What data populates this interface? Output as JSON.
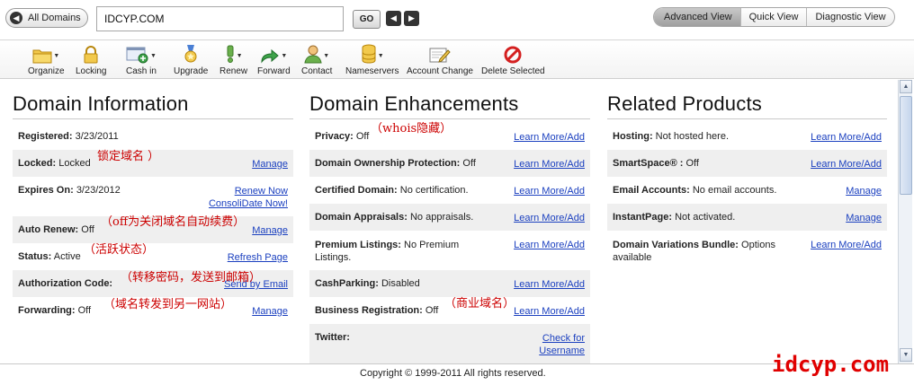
{
  "topbar": {
    "back_label": "All Domains",
    "domain_value": "IDCYP.COM",
    "go_label": "GO",
    "view_tabs": [
      "Advanced View",
      "Quick View",
      "Diagnostic View"
    ]
  },
  "toolbar": {
    "items": [
      {
        "label": "Organize",
        "icon": "folder-icon"
      },
      {
        "label": "Locking",
        "icon": "lock-icon"
      },
      {
        "label": "Cash in",
        "icon": "cash-in-icon"
      },
      {
        "label": "Upgrade",
        "icon": "medal-icon"
      },
      {
        "label": "Renew",
        "icon": "renew-icon"
      },
      {
        "label": "Forward",
        "icon": "forward-arrow-icon"
      },
      {
        "label": "Contact",
        "icon": "contact-person-icon"
      },
      {
        "label": "Nameservers",
        "icon": "database-icon"
      },
      {
        "label": "Account Change",
        "icon": "edit-pencil-icon"
      },
      {
        "label": "Delete Selected",
        "icon": "no-entry-icon"
      }
    ]
  },
  "domain_info": {
    "title": "Domain Information",
    "rows": [
      {
        "label": "Registered:",
        "value": "3/23/2011"
      },
      {
        "label": "Locked:",
        "value": "Locked",
        "link": "Manage",
        "note": "锁定域名 ）"
      },
      {
        "label": "Expires On:",
        "value": "3/23/2012",
        "link": "Renew Now",
        "link2": "ConsoliDate Now!"
      },
      {
        "label": "Auto Renew:",
        "value": "Off",
        "link": "Manage",
        "note": "（off为关闭域名自动续费）"
      },
      {
        "label": "Status:",
        "value": "Active",
        "link": "Refresh Page",
        "note": "（活跃状态）"
      },
      {
        "label": "Authorization Code:",
        "value": "",
        "link": "Send by Email",
        "note": "（转移密码，发送到邮箱）"
      },
      {
        "label": "Forwarding:",
        "value": "Off",
        "link": "Manage",
        "note": "（域名转发到另一网站）"
      }
    ]
  },
  "enhancements": {
    "title": "Domain Enhancements",
    "rows": [
      {
        "label": "Privacy:",
        "value": "Off",
        "link": "Learn More/Add",
        "note": "（whois隐藏）"
      },
      {
        "label": "Domain Ownership Protection:",
        "value": "Off",
        "link": "Learn More/Add"
      },
      {
        "label": "Certified Domain:",
        "value": "No certification.",
        "link": "Learn More/Add"
      },
      {
        "label": "Domain Appraisals:",
        "value": "No appraisals.",
        "link": "Learn More/Add"
      },
      {
        "label": "Premium Listings:",
        "value": "No Premium",
        "value2": "Listings.",
        "link": "Learn More/Add"
      },
      {
        "label": "CashParking:",
        "value": "Disabled",
        "link": "Learn More/Add"
      },
      {
        "label": "Business Registration:",
        "value": "Off",
        "link": "Learn More/Add",
        "note": "（商业域名）"
      },
      {
        "label": "Twitter:",
        "value": "",
        "link": "Check for",
        "link2": "Username"
      }
    ]
  },
  "related": {
    "title": "Related Products",
    "rows": [
      {
        "label": "Hosting:",
        "value": "Not hosted here.",
        "link": "Learn More/Add"
      },
      {
        "label": "SmartSpace® :",
        "value": "Off",
        "link": "Learn More/Add"
      },
      {
        "label": "Email Accounts:",
        "value": "No email accounts.",
        "link": "Manage"
      },
      {
        "label": "InstantPage:",
        "value": "Not activated.",
        "link": "Manage"
      },
      {
        "label": "Domain Variations Bundle:",
        "value": "Options",
        "value2": "available",
        "link": "Learn More/Add"
      }
    ]
  },
  "footer": {
    "copyright": "Copyright © 1999-2011 All rights reserved."
  },
  "watermark": "idcyp.com"
}
